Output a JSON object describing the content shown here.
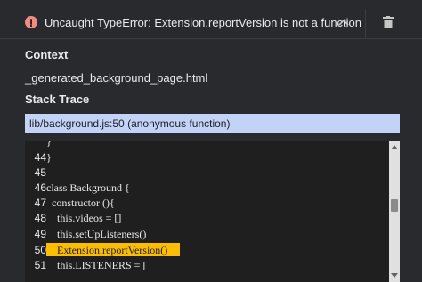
{
  "error": {
    "title": "Uncaught TypeError: Extension.reportVersion is not a function",
    "icon": "error-circle-icon",
    "color": "#f28b82"
  },
  "context": {
    "heading": "Context",
    "value": "_generated_background_page.html"
  },
  "stack_trace": {
    "heading": "Stack Trace",
    "frame": "lib/background.js:50 (anonymous function)"
  },
  "code_lines": [
    {
      "num": "",
      "text": "}"
    },
    {
      "num": "44",
      "text": "}"
    },
    {
      "num": "45",
      "text": ""
    },
    {
      "num": "46",
      "text": "class Background {"
    },
    {
      "num": "47",
      "text": "  constructor (){"
    },
    {
      "num": "48",
      "text": "    this.videos = []"
    },
    {
      "num": "49",
      "text": "    this.setUpListeners()"
    },
    {
      "num": "50",
      "text": "    Extension.reportVersion()"
    },
    {
      "num": "51",
      "text": "    this.LISTENERS = ["
    }
  ],
  "highlight_color": "#fbbc04",
  "accent_trace_bg": "#c2d3f7"
}
